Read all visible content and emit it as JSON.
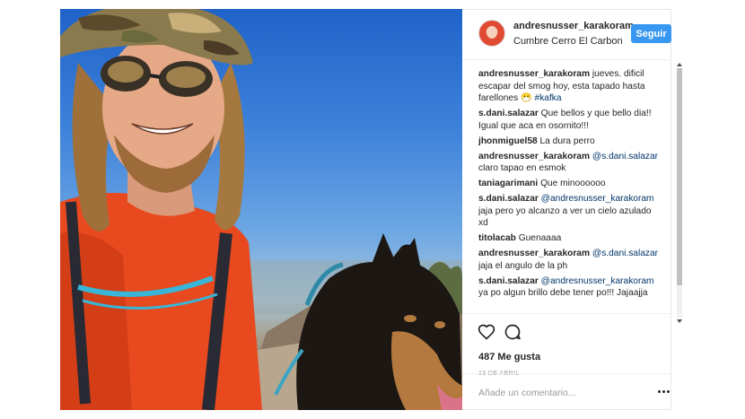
{
  "header": {
    "username": "andresnusser_karakoram",
    "location": "Cumbre Cerro El Carbon",
    "follow_label": "Seguir"
  },
  "comments": [
    {
      "user": "andresnusser_karakoram",
      "text": " jueves. dificil escapar del smog hoy, esta tapado hasta farellones ",
      "emoji": "😷",
      "tag": " #kafka"
    },
    {
      "user": "s.dani.salazar",
      "text": " Que bellos y que bello dia!! Igual que aca en osornito!!!"
    },
    {
      "user": "jhonmiguel58",
      "text": " La dura perro"
    },
    {
      "user": "andresnusser_karakoram",
      "mention": " @s.dani.salazar",
      "text": " claro tapao en esmok"
    },
    {
      "user": "taniagarimani",
      "text": " Que minoooooo"
    },
    {
      "user": "s.dani.salazar",
      "mention": " @andresnusser_karakoram",
      "text": " jaja pero yo alcanzo a ver un cielo azulado xd"
    },
    {
      "user": "titolacab",
      "text": " Guenaaaa"
    },
    {
      "user": "andresnusser_karakoram",
      "mention": " @s.dani.salazar",
      "text": " jaja el angulo de la ph"
    },
    {
      "user": "s.dani.salazar",
      "mention": " @andresnusser_karakoram",
      "text": " ya po algun brillo debe tener po!!! Jajaajja"
    }
  ],
  "actions": {
    "likes": "487 Me gusta",
    "date": "13 DE ABRIL",
    "comment_placeholder": "Añade un comentario..."
  },
  "colors": {
    "follow_button": "#3897f0",
    "mention": "#003569",
    "date": "#999999"
  },
  "icons": [
    "heart-icon",
    "comment-icon",
    "more-options-icon"
  ]
}
